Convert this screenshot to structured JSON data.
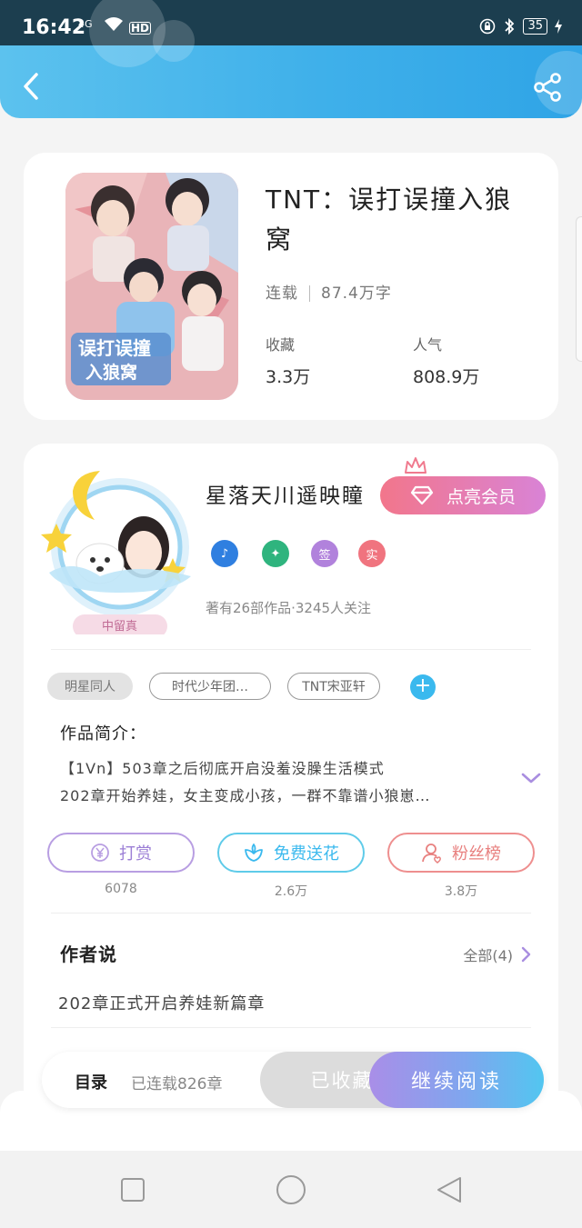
{
  "status_bar": {
    "time": "16:42",
    "network": "4G",
    "hd": "HD",
    "battery": "35"
  },
  "colors": {
    "header": "#3fb0ea",
    "accent_pink": "#f2768b",
    "accent_purple": "#b182dc",
    "accent_cyan": "#3ab9ee",
    "accent_red": "#e8807f"
  },
  "book": {
    "title": "TNT：误打误撞入狼窝",
    "status": "连载",
    "word_count": "87.4万字",
    "favorites_label": "收藏",
    "favorites_value": "3.3万",
    "popularity_label": "人气",
    "popularity_value": "808.9万",
    "cover_text": "误打误撞入狼窝"
  },
  "author": {
    "name": "星落天川遥映瞳",
    "vip_label": "点亮会员",
    "avatar_tag": "中留真",
    "badges": [
      "♪",
      "✦",
      "签",
      "实"
    ],
    "stats": "著有26部作品·3245人关注"
  },
  "tags": [
    "明星同人",
    "时代少年团…",
    "TNT宋亚轩"
  ],
  "intro": {
    "title": "作品简介：",
    "line1": "【1Vn】503章之后彻底开启没羞没臊生活模式",
    "line2": "202章开始养娃，女主变成小孩，一群不靠谱小狼崽…"
  },
  "actions": [
    {
      "label": "打赏",
      "count": "6078",
      "icon": "yen-coin-icon"
    },
    {
      "label": "免费送花",
      "count": "2.6万",
      "icon": "flower-icon"
    },
    {
      "label": "粉丝榜",
      "count": "3.8万",
      "icon": "fan-user-icon"
    }
  ],
  "author_say": {
    "title": "作者说",
    "all_label": "全部(4)",
    "text": "202章正式开启养娃新篇章"
  },
  "bottom_bar": {
    "toc_label": "目录",
    "toc_count": "已连载826章",
    "collected_label": "已收藏",
    "read_label": "继续阅读"
  }
}
